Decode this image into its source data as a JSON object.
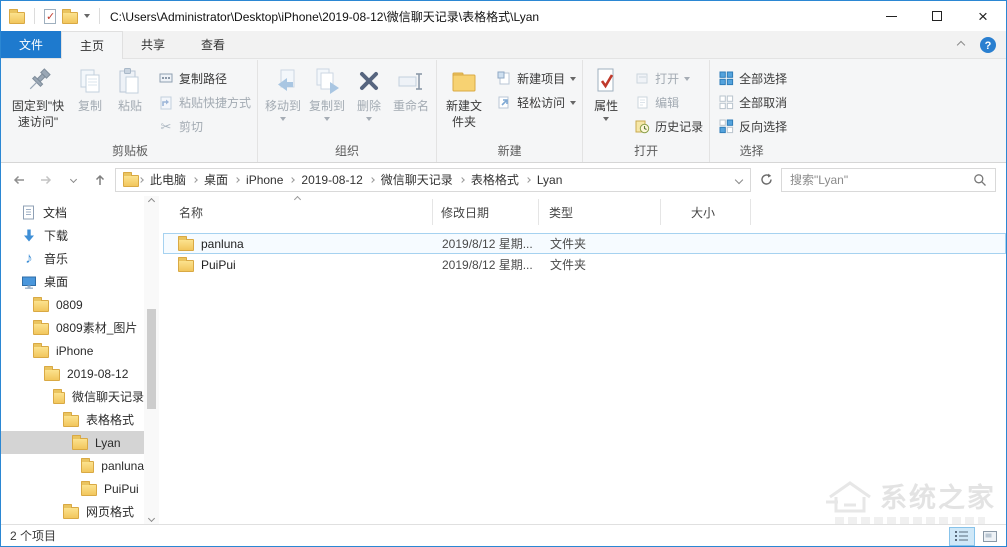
{
  "titlebar": {
    "path": "C:\\Users\\Administrator\\Desktop\\iPhone\\2019-08-12\\微信聊天记录\\表格格式\\Lyan",
    "quick_access_icons": [
      "folder-icon",
      "properties-check-icon",
      "folder-icon",
      "dropdown-arrow-icon"
    ]
  },
  "tabs": {
    "file": "文件",
    "home": "主页",
    "share": "共享",
    "view": "查看"
  },
  "ribbon": {
    "clipboard": {
      "label": "剪贴板",
      "pin": "固定到\"快速访问\"",
      "copy": "复制",
      "paste": "粘贴",
      "copy_path": "复制路径",
      "paste_shortcut": "粘贴快捷方式",
      "cut": "剪切"
    },
    "organize": {
      "label": "组织",
      "move_to": "移动到",
      "copy_to": "复制到",
      "delete": "删除",
      "rename": "重命名"
    },
    "new": {
      "label": "新建",
      "new_folder": "新建文件夹",
      "new_item": "新建项目",
      "easy_access": "轻松访问"
    },
    "open": {
      "label": "打开",
      "properties": "属性",
      "open": "打开",
      "edit": "编辑",
      "history": "历史记录"
    },
    "select": {
      "label": "选择",
      "select_all": "全部选择",
      "select_none": "全部取消",
      "invert": "反向选择"
    }
  },
  "addressbar": {
    "crumbs": [
      "此电脑",
      "桌面",
      "iPhone",
      "2019-08-12",
      "微信聊天记录",
      "表格格式",
      "Lyan"
    ],
    "search_placeholder": "搜索\"Lyan\""
  },
  "sidebar": {
    "items": [
      {
        "label": "文档",
        "icon": "document-icon",
        "level": 0,
        "selected": false
      },
      {
        "label": "下载",
        "icon": "download-icon",
        "level": 0,
        "selected": false
      },
      {
        "label": "音乐",
        "icon": "music-icon",
        "level": 0,
        "selected": false
      },
      {
        "label": "桌面",
        "icon": "desktop-icon",
        "level": 0,
        "selected": false
      },
      {
        "label": "0809",
        "icon": "folder-icon",
        "level": 1,
        "selected": false
      },
      {
        "label": "0809素材_图片",
        "icon": "folder-icon",
        "level": 1,
        "selected": false
      },
      {
        "label": "iPhone",
        "icon": "folder-icon",
        "level": 1,
        "selected": false
      },
      {
        "label": "2019-08-12",
        "icon": "folder-icon",
        "level": 2,
        "selected": false
      },
      {
        "label": "微信聊天记录",
        "icon": "folder-icon",
        "level": 3,
        "selected": false
      },
      {
        "label": "表格格式",
        "icon": "folder-icon",
        "level": 4,
        "selected": false
      },
      {
        "label": "Lyan",
        "icon": "folder-icon",
        "level": 5,
        "selected": true
      },
      {
        "label": "panluna",
        "icon": "folder-icon",
        "level": 6,
        "selected": false
      },
      {
        "label": "PuiPui",
        "icon": "folder-icon",
        "level": 6,
        "selected": false
      },
      {
        "label": "网页格式",
        "icon": "folder-icon",
        "level": 4,
        "selected": false
      }
    ]
  },
  "filelist": {
    "columns": [
      "名称",
      "修改日期",
      "类型",
      "大小"
    ],
    "sort": {
      "column": "名称",
      "direction": "asc"
    },
    "rows": [
      {
        "name": "panluna",
        "date": "2019/8/12 星期...",
        "type": "文件夹",
        "size": ""
      },
      {
        "name": "PuiPui",
        "date": "2019/8/12 星期...",
        "type": "文件夹",
        "size": ""
      }
    ]
  },
  "statusbar": {
    "count": "2 个项目"
  },
  "watermark": {
    "text": "系统之家"
  },
  "colors": {
    "accent_blue": "#1e7ace",
    "window_border": "#2b87d3",
    "folder_yellow": "#f2c65d",
    "sidebar_selection": "#d4d4d4",
    "row_highlight_border": "#a6d2f0"
  }
}
